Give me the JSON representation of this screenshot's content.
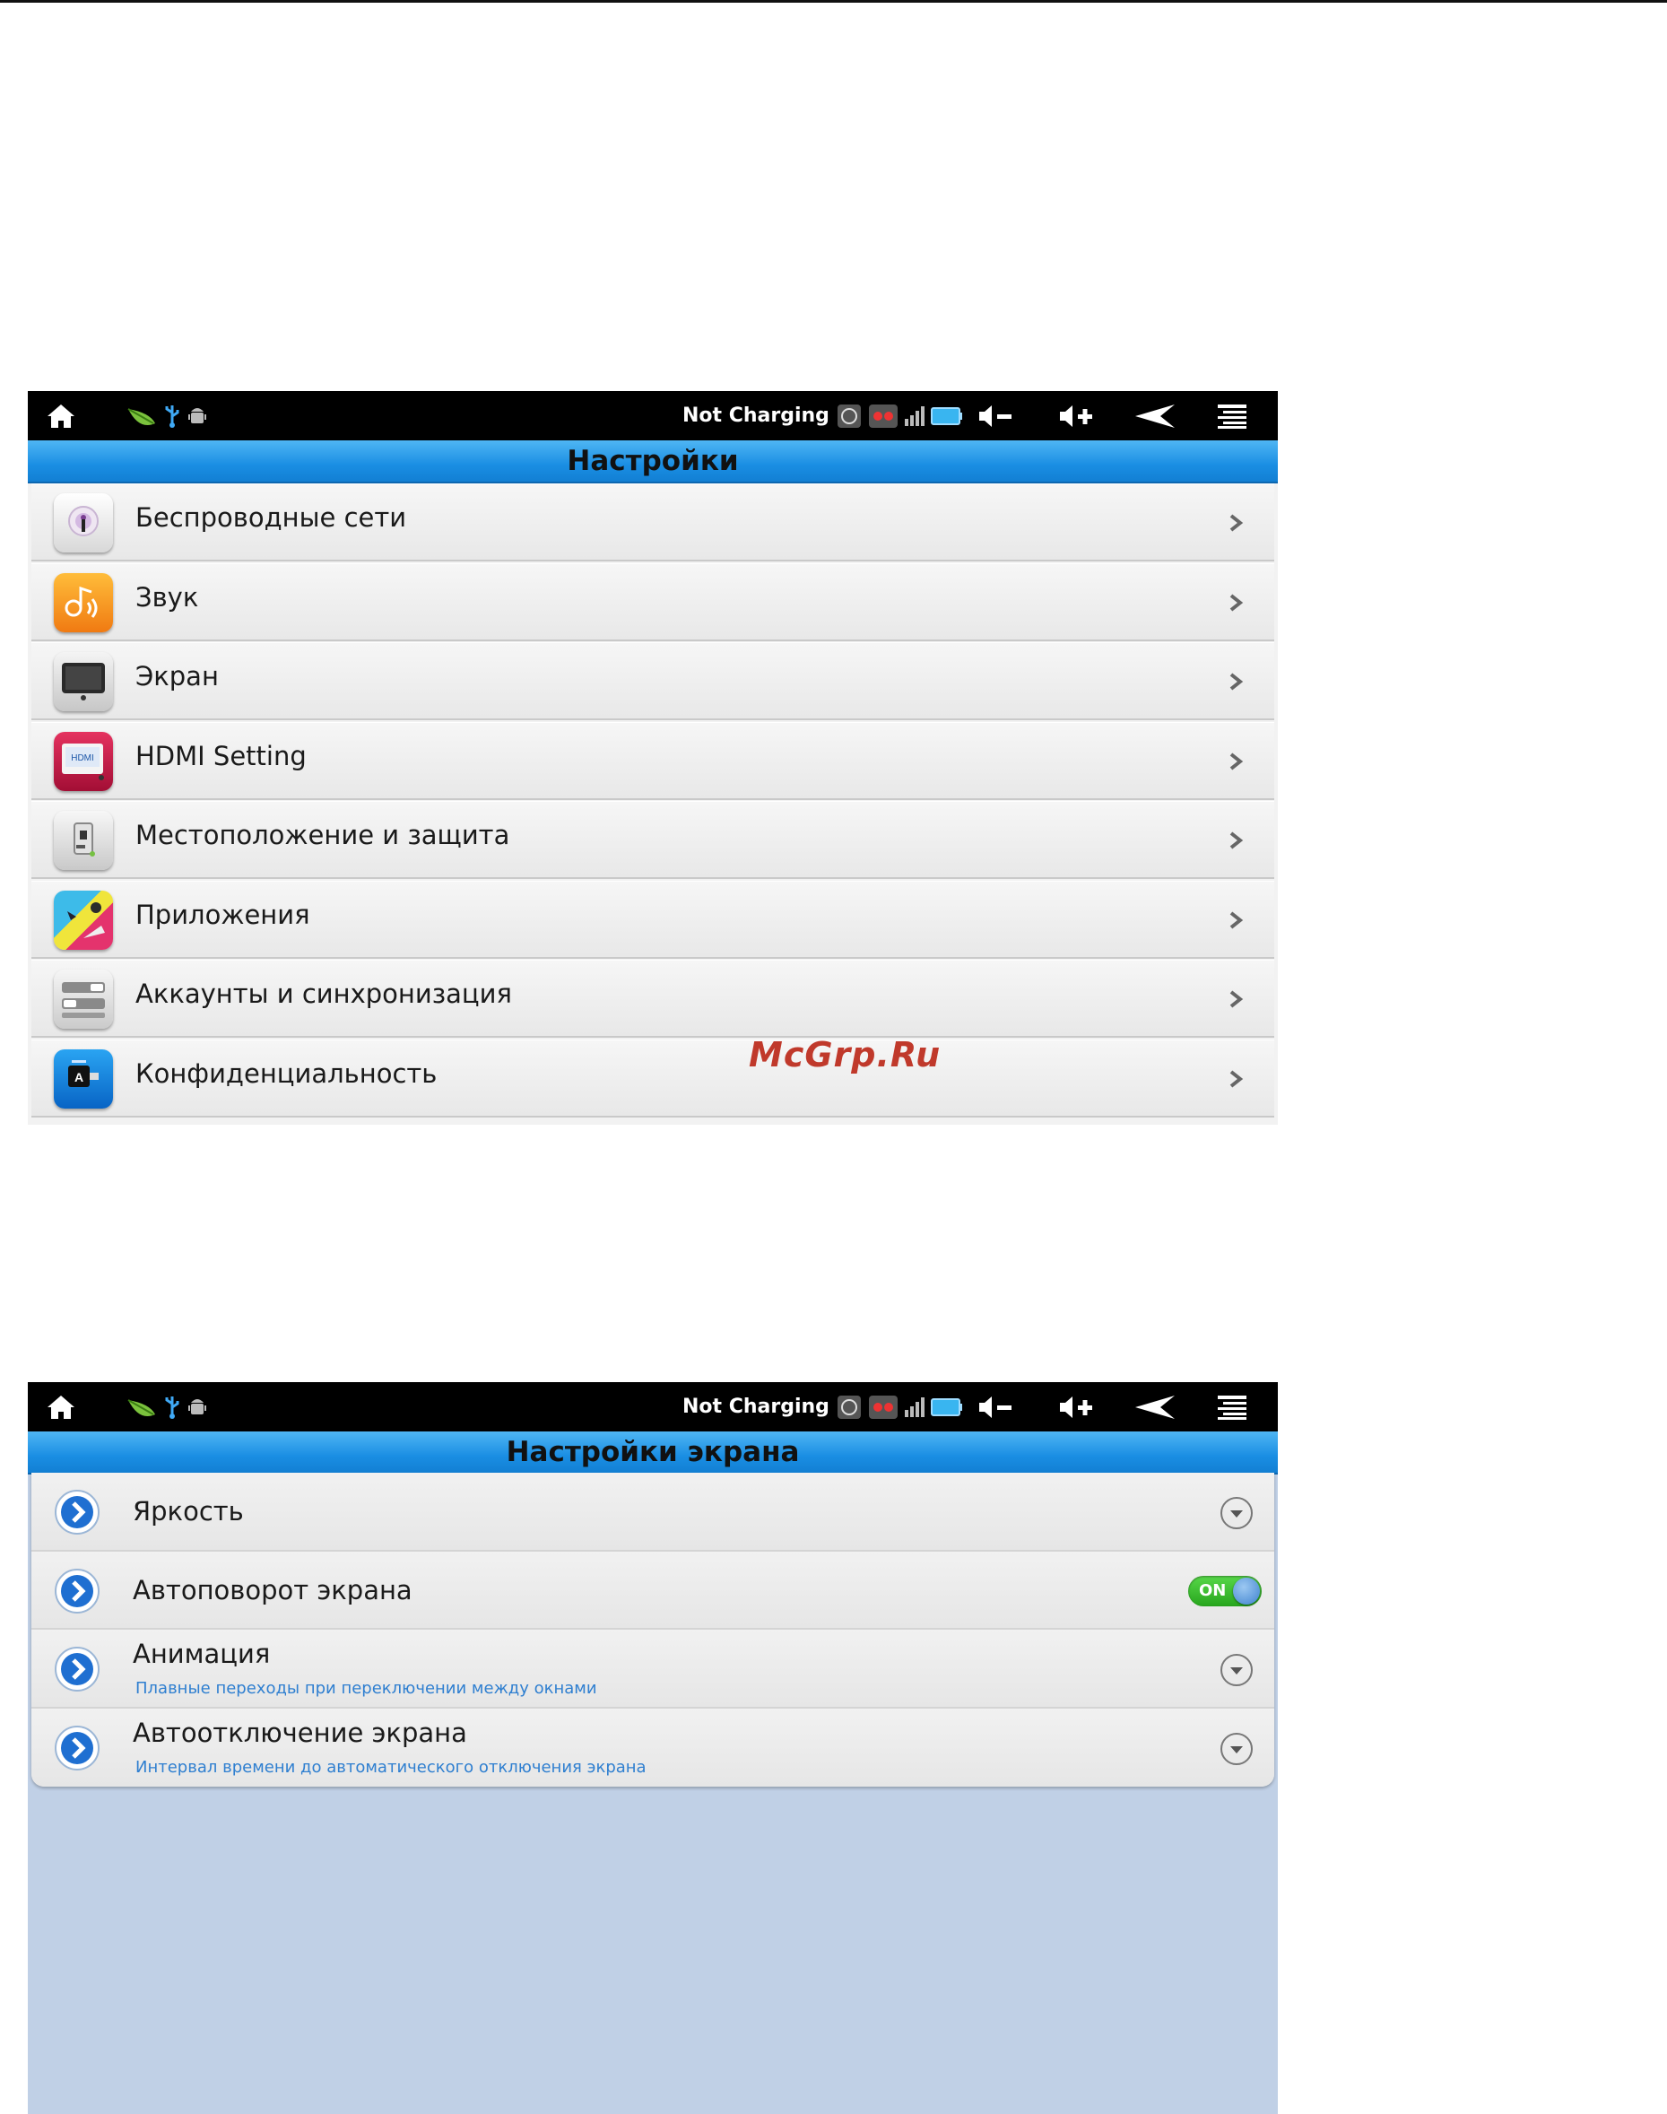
{
  "watermark": "McGrp.Ru",
  "statusbar": {
    "charging_text": "Not Charging",
    "icons": [
      "home-icon",
      "notification-leaf-icon",
      "usb-icon",
      "android-debug-icon",
      "alarm-icon",
      "vpn-icon",
      "signal-icon",
      "battery-icon",
      "volume-down-icon",
      "volume-up-icon",
      "back-icon",
      "menu-icon"
    ]
  },
  "screen1": {
    "title": "Настройки",
    "items": [
      {
        "label": "Беспроводные сети",
        "icon": "wireless-icon"
      },
      {
        "label": "Звук",
        "icon": "sound-icon"
      },
      {
        "label": "Экран",
        "icon": "display-icon"
      },
      {
        "label": "HDMI Setting",
        "icon": "hdmi-icon",
        "icon_text": "HDMI"
      },
      {
        "label": "Местоположение и защита",
        "icon": "location-security-icon"
      },
      {
        "label": "Приложения",
        "icon": "applications-icon"
      },
      {
        "label": "Аккаунты и синхронизация",
        "icon": "accounts-sync-icon"
      },
      {
        "label": "Конфиденциальность",
        "icon": "privacy-icon",
        "icon_text": "A"
      }
    ]
  },
  "screen2": {
    "title": "Настройки экрана",
    "items": [
      {
        "label": "Яркость",
        "sub": "",
        "control": "dropdown"
      },
      {
        "label": "Автоповорот экрана",
        "sub": "",
        "control": "toggle",
        "toggle_text": "ON",
        "toggle_on": true
      },
      {
        "label": "Анимация",
        "sub": "Плавные переходы при переключении между окнами",
        "control": "dropdown"
      },
      {
        "label": "Автоотключение экрана",
        "sub": "Интервал времени до автоматического отключения экрана",
        "control": "dropdown"
      }
    ]
  },
  "colors": {
    "title_bar": "#1a8ee3",
    "status_bar": "#000000",
    "subtext": "#2f7fd0",
    "toggle_on": "#27a51d",
    "screen2_background": "#c0d0e6",
    "watermark": "#c0392b"
  }
}
